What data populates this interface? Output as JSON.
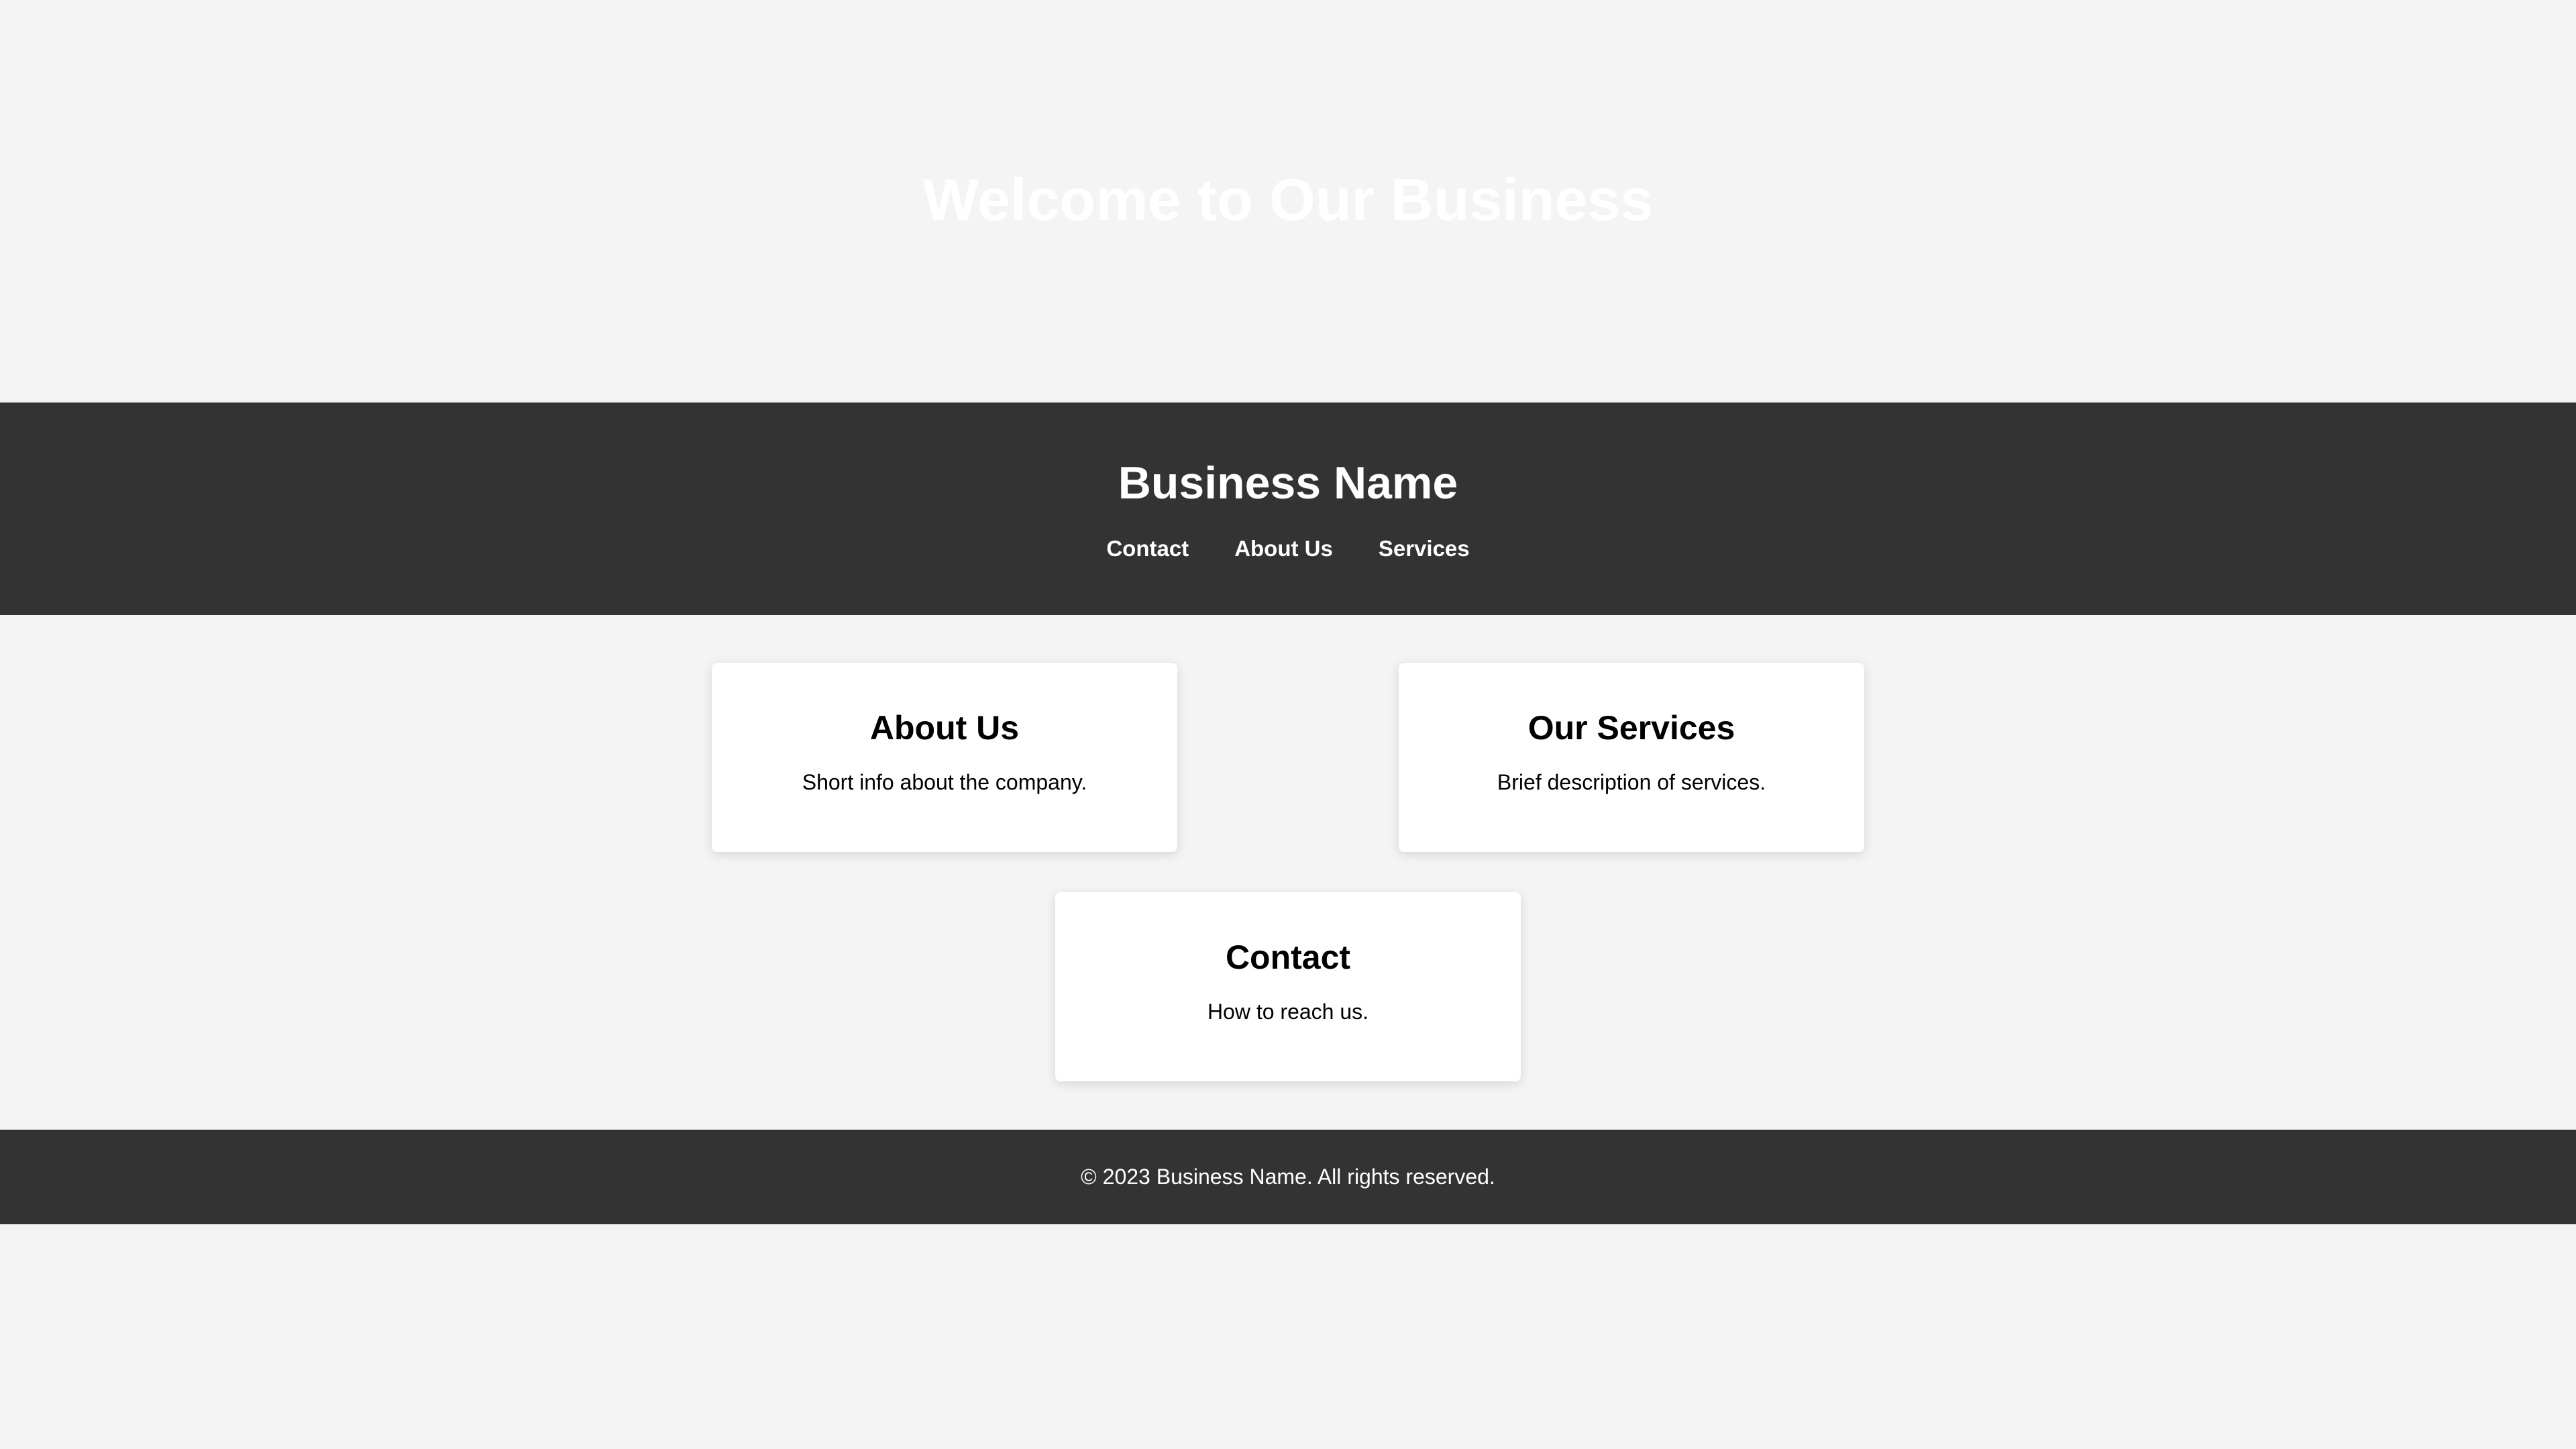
{
  "hero": {
    "title": "Welcome to Our Business"
  },
  "header": {
    "brand": "Business Name",
    "nav": [
      {
        "label": "Contact"
      },
      {
        "label": "About Us"
      },
      {
        "label": "Services"
      }
    ]
  },
  "cards": {
    "about": {
      "title": "About Us",
      "text": "Short info about the company."
    },
    "services": {
      "title": "Our Services",
      "text": "Brief description of services."
    },
    "contact": {
      "title": "Contact",
      "text": "How to reach us."
    }
  },
  "footer": {
    "text": "© 2023 Business Name. All rights reserved."
  },
  "colors": {
    "page_background": "#f4f4f4",
    "header_background": "#333333",
    "footer_background": "#333333",
    "card_background": "#ffffff",
    "text_light": "#ffffff",
    "text_dark": "#000000"
  }
}
